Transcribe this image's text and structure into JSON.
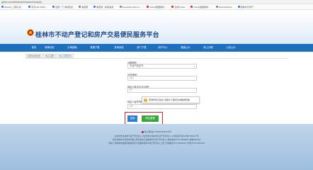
{
  "browser": {
    "url": "glbdc.cn/online/public/search/tohpUs"
  },
  "bookmarks": [
    {
      "label": "hao123_上网从这...",
      "icon": "web-icon",
      "color": "#3b7dd8"
    },
    {
      "label": "京东(JD.COM)...",
      "icon": "web-icon",
      "color": "#3b7dd8"
    },
    {
      "label": "百度一下,你就知道",
      "icon": "web-icon",
      "color": "#3b7dd8"
    },
    {
      "label": "淘宝网",
      "icon": "web-icon",
      "color": "#888888"
    },
    {
      "label": "淘宝网 - 淘!我喜欢",
      "icon": "web-icon",
      "color": "#3b7dd8"
    },
    {
      "label": "SuperMap iServer...",
      "icon": "web-icon",
      "color": "#888888"
    },
    {
      "label": "Oracle数据库的...",
      "icon": "web-icon",
      "color": "#d9342b"
    },
    {
      "label": "在线Oracle",
      "icon": "web-icon",
      "color": "#d9342b"
    },
    {
      "label": "Oracle数据库的...",
      "icon": "web-icon",
      "color": "#d9342b"
    },
    {
      "label": "SNAI-Webinar",
      "icon": "web-icon",
      "color": "#888888"
    },
    {
      "label": "桂林市不动产...",
      "icon": "web-icon",
      "color": "#3b7dd8"
    }
  ],
  "header": {
    "title": "桂林市不动产登记和房产交易便民服务平台"
  },
  "nav": [
    {
      "label": "首页",
      "active": false
    },
    {
      "label": "新闻动态",
      "active": false
    },
    {
      "label": "办事指南",
      "active": false
    },
    {
      "label": "表格下载",
      "active": false
    },
    {
      "label": "查询系统",
      "active": false
    },
    {
      "label": "部门下载",
      "active": false
    },
    {
      "label": "用户中心",
      "active": false
    },
    {
      "label": "楼盘公示",
      "active": false
    },
    {
      "label": "网上办理",
      "active": false
    },
    {
      "label": "公告公示",
      "active": false
    }
  ],
  "breadcrumb": [
    "您所在的位置",
    "电子证照",
    "电子证照查询"
  ],
  "form": {
    "cert_type_label": "证照类型:",
    "cert_type_value": "不动产权证书",
    "cert_no_label": "证书号码*",
    "cert_no_value": "桂(2",
    "holder_name_label": "持证人姓名/企业名称*",
    "holder_name_value": "黄",
    "holder_id_label": "持证人证件号码*",
    "holder_id_value": "450"
  },
  "tooltip": {
    "text": "查询申请已提交,请移步小程序在电脑端查看"
  },
  "buttons": {
    "query": "查询",
    "reset": "清空重置"
  },
  "footer": {
    "line1": "桂公网安备 45030202000178号",
    "line2": "主办单位:桂林市不动产登记中心 | 技术支持:桂林市不动产登记中心 | ICP备案号:桂ICP备17004217号",
    "line3": "地址:桂林市七星区中华路与普陀路交汇处桂林市不动产登记中心 | 联系电话:0773-3695069 | 邮编:541004",
    "line4": "地址:广西桂林市临桂区临桂新区人民路桂林市不动产登记中心二楼 | 咨询电话:0773-6021215 | 传真:0773-6021215"
  }
}
